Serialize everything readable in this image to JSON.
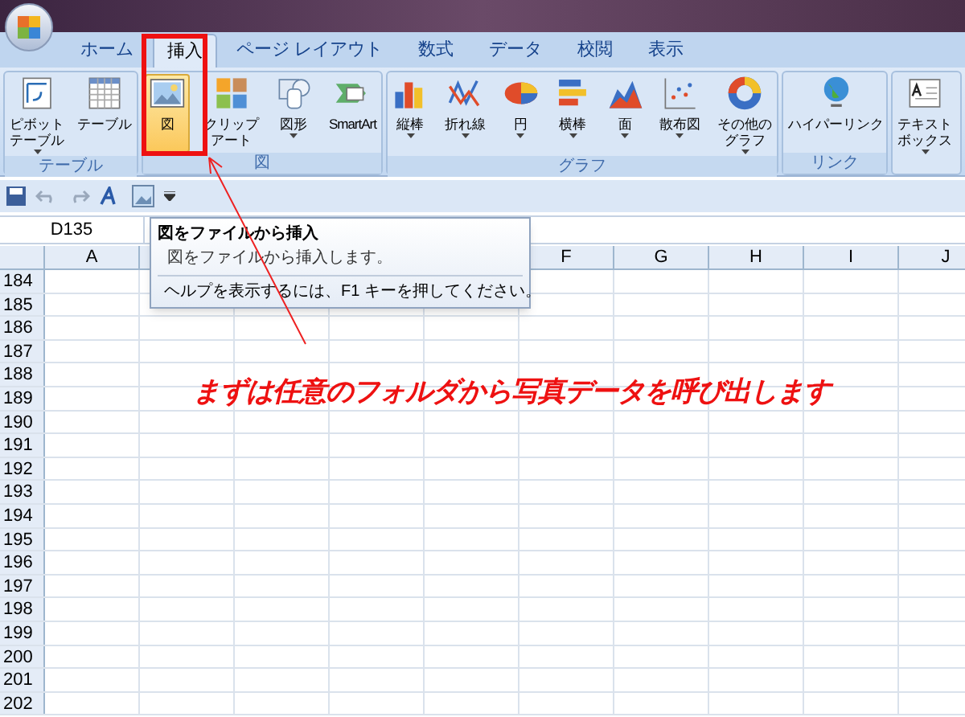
{
  "tabs": [
    {
      "label": "ホーム",
      "selected": false
    },
    {
      "label": "挿入",
      "selected": true
    },
    {
      "label": "ページ レイアウト",
      "selected": false
    },
    {
      "label": "数式",
      "selected": false
    },
    {
      "label": "データ",
      "selected": false
    },
    {
      "label": "校閲",
      "selected": false
    },
    {
      "label": "表示",
      "selected": false
    }
  ],
  "ribbon_groups": [
    {
      "label": "テーブル",
      "buttons": [
        {
          "lines": [
            "ピボット",
            "テーブル"
          ],
          "menu": true,
          "selected": false
        },
        {
          "lines": [
            "テーブル"
          ],
          "menu": false,
          "selected": false
        }
      ]
    },
    {
      "label": "図",
      "buttons": [
        {
          "lines": [
            "図"
          ],
          "menu": false,
          "selected": true
        },
        {
          "lines": [
            "クリップ",
            "アート"
          ],
          "menu": false,
          "selected": false
        },
        {
          "lines": [
            "図形"
          ],
          "menu": true,
          "selected": false
        },
        {
          "lines": [
            "SmartArt"
          ],
          "menu": false,
          "selected": false
        }
      ]
    },
    {
      "label": "グラフ",
      "buttons": [
        {
          "lines": [
            "縦棒"
          ],
          "menu": true,
          "selected": false
        },
        {
          "lines": [
            "折れ線"
          ],
          "menu": true,
          "selected": false
        },
        {
          "lines": [
            "円"
          ],
          "menu": true,
          "selected": false
        },
        {
          "lines": [
            "横棒"
          ],
          "menu": true,
          "selected": false
        },
        {
          "lines": [
            "面"
          ],
          "menu": true,
          "selected": false
        },
        {
          "lines": [
            "散布図"
          ],
          "menu": true,
          "selected": false
        },
        {
          "lines": [
            "その他の",
            "グラフ"
          ],
          "menu": true,
          "selected": false
        }
      ]
    },
    {
      "label": "リンク",
      "buttons": [
        {
          "lines": [
            "ハイパーリンク"
          ],
          "menu": false,
          "selected": false
        }
      ]
    },
    {
      "buttons": [
        {
          "lines": [
            "テキスト",
            "ボックス"
          ],
          "menu": true,
          "selected": false
        }
      ]
    }
  ],
  "name_box": "D135",
  "tooltip": {
    "title": "図をファイルから挿入",
    "description": "図をファイルから挿入します。",
    "help": "ヘルプを表示するには、F1 キーを押してください。"
  },
  "columns_left": [
    "A"
  ],
  "columns_right": [
    "F",
    "G",
    "H",
    "I",
    "J"
  ],
  "rows": [
    "184",
    "185",
    "186",
    "187",
    "188",
    "189",
    "190",
    "191",
    "192",
    "193",
    "194",
    "195",
    "196",
    "197",
    "198",
    "199",
    "200",
    "201",
    "202"
  ],
  "annotation": "まずは任意のフォルダから写真データを呼び出します"
}
